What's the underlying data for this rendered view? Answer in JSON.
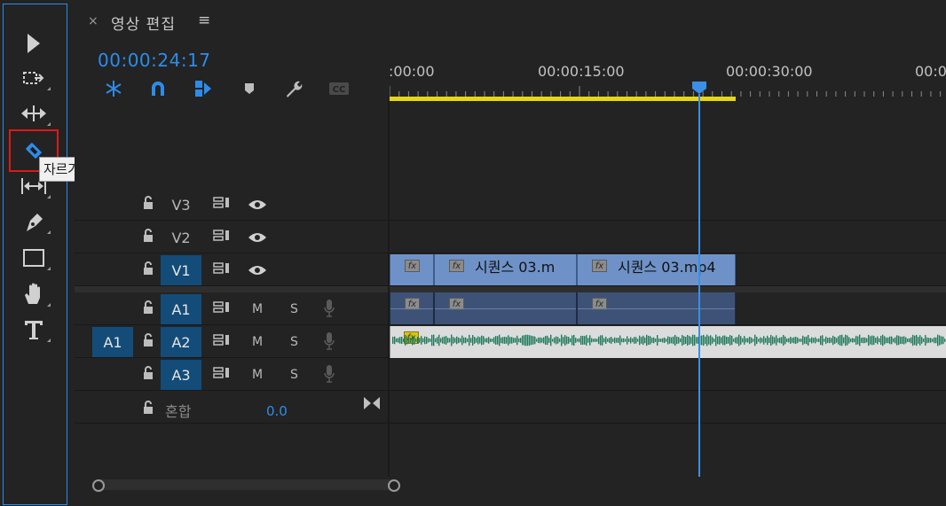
{
  "tools": {
    "tooltip": "자르기 도구(C)",
    "items": [
      "selection-tool",
      "track-select-tool",
      "ripple-edit-tool",
      "razor-tool",
      "slip-tool",
      "pen-tool",
      "rectangle-tool",
      "hand-tool",
      "type-tool"
    ]
  },
  "panel": {
    "close": "×",
    "title": "영상 편집",
    "menu": "≡"
  },
  "timecode": "00:00:24:17",
  "ruler": {
    "labels": [
      ":00:00",
      "00:00:15:00",
      "00:00:30:00",
      "00:0"
    ]
  },
  "tracks": {
    "video": [
      {
        "name": "V3",
        "selected": false
      },
      {
        "name": "V2",
        "selected": false
      },
      {
        "name": "V1",
        "selected": true
      }
    ],
    "audio": [
      {
        "name": "A1",
        "selected": true,
        "m": "M",
        "s": "S"
      },
      {
        "name": "A2",
        "selected": true,
        "m": "M",
        "s": "S",
        "source": "A1"
      },
      {
        "name": "A3",
        "selected": true,
        "m": "M",
        "s": "S"
      }
    ],
    "mix": {
      "label": "혼합",
      "value": "0.0"
    }
  },
  "clips": {
    "v1": [
      {
        "label": ""
      },
      {
        "label": "시퀀스 03.m"
      },
      {
        "label": "시퀀스 03.mp4"
      }
    ],
    "fx": "fx"
  },
  "colors": {
    "accent": "#2d8ceb",
    "selected_track": "#134c79",
    "video_clip": "#6e92c8",
    "audio_clip": "#3d5276",
    "work_area": "#e6d616",
    "waveform": "#1f7a5a"
  }
}
